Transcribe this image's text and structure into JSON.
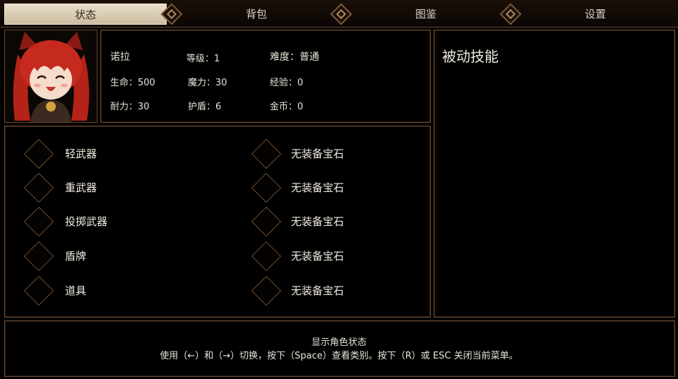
{
  "tabs": [
    {
      "label": "状态",
      "active": true
    },
    {
      "label": "背包",
      "active": false
    },
    {
      "label": "图鉴",
      "active": false
    },
    {
      "label": "设置",
      "active": false
    }
  ],
  "character": {
    "name": "诺拉",
    "level": "等级：1",
    "difficulty": "难度：普通",
    "hp": "生命：500",
    "mp": "魔力：30",
    "exp": "经验：0",
    "stamina": "耐力：30",
    "shield": "护盾：6",
    "gold": "金币：0"
  },
  "passive": {
    "title": "被动技能"
  },
  "equipment": [
    "轻武器",
    "重武器",
    "投掷武器",
    "盾牌",
    "道具"
  ],
  "gems": [
    "无装备宝石",
    "无装备宝石",
    "无装备宝石",
    "无装备宝石",
    "无装备宝石"
  ],
  "help": {
    "title": "显示角色状态",
    "text": "使用（←）和（→）切换，按下（Space）查看类别。按下（R）或 ESC 关闭当前菜单。"
  },
  "colors": {
    "frame": "#6b4a2b",
    "active_tab": "#e0d4bc",
    "background": "#000000"
  },
  "icons": {
    "portrait": "red-haired-catgirl-portrait",
    "separator": "diamond-ornament-icon"
  }
}
